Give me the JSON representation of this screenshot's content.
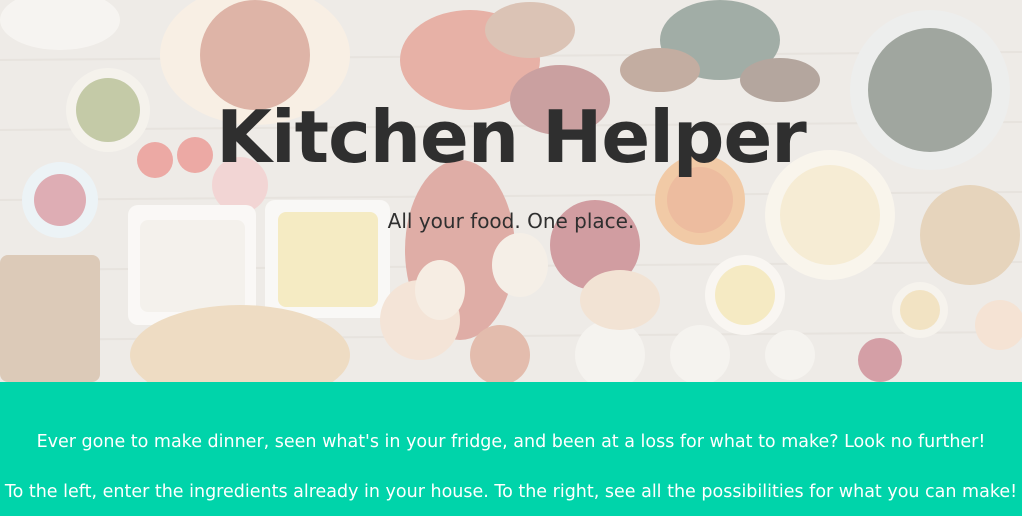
{
  "hero": {
    "title": "Kitchen Helper",
    "subtitle": "All your food. One place.",
    "background_image": "food-table-photo"
  },
  "intro": {
    "line1": "Ever gone to make dinner, seen what's in your fridge, and been at a loss for what to make? Look no further!",
    "line2": "To the left, enter the ingredients already in your house. To the right, see all the possibilities for what you can make!"
  },
  "colors": {
    "accent": "#00d4aa",
    "title_text": "#2f2f2f",
    "intro_text": "#ffffff"
  }
}
